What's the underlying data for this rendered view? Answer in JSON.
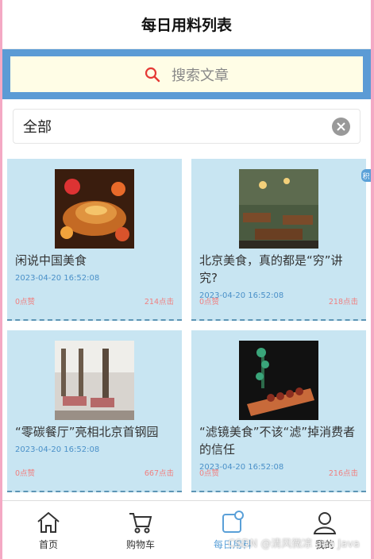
{
  "header": {
    "title": "每日用料列表"
  },
  "search": {
    "placeholder": "搜索文章"
  },
  "filter": {
    "value": "全部"
  },
  "articles": [
    {
      "title": "闲说中国美食",
      "date": "2023-04-20 16:52:08",
      "likes": "0点赞",
      "clicks": "214点击"
    },
    {
      "title": "北京美食，真的都是“穷”讲究?",
      "date": "2023-04-20 16:52:08",
      "likes": "0点赞",
      "clicks": "218点击"
    },
    {
      "title": "“零碳餐厅”亮相北京首钢园",
      "date": "2023-04-20 16:52:08",
      "likes": "0点赞",
      "clicks": "667点击"
    },
    {
      "title": "“滤镜美食”不该“滤”掉消费者的信任",
      "date": "2023-04-20 16:52:08",
      "likes": "0点赞",
      "clicks": "216点击"
    }
  ],
  "tabbar": {
    "home": "首页",
    "cart": "购物车",
    "daily": "每日用料",
    "profile": "我的"
  },
  "watermark": "CSDN @清风微凉 aaa Java",
  "float_label": "积"
}
